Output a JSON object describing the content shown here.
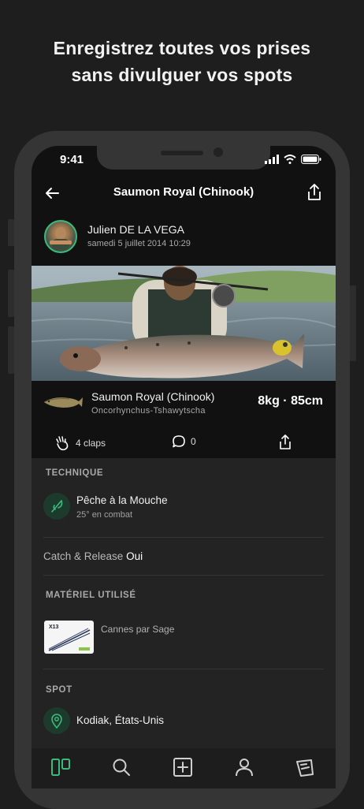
{
  "headline": {
    "line1": "Enregistrez toutes vos prises",
    "line2": "sans divulguer vos spots"
  },
  "status_bar": {
    "time": "9:41",
    "icons": [
      "signal-icon",
      "wifi-icon",
      "battery-icon"
    ]
  },
  "header": {
    "title": "Saumon Royal (Chinook)"
  },
  "author": {
    "name": "Julien  DE LA VEGA",
    "date": "samedi 5 juillet 2014 10:29"
  },
  "catch": {
    "species": "Saumon Royal (Chinook)",
    "scientific": "Oncorhynchus-Tshawytscha",
    "size": "8kg · 85cm"
  },
  "actions": {
    "claps": "4 claps",
    "comments": "0"
  },
  "technique": {
    "label": "TECHNIQUE",
    "name": "Pêche à la Mouche",
    "detail": "25° en combat"
  },
  "catch_release": {
    "label": "Catch & Release",
    "value": "Oui"
  },
  "material": {
    "label": "MATÉRIEL UTILISÉ",
    "item": "Cannes par Sage",
    "card_text": "X13"
  },
  "spot": {
    "label": "SPOT",
    "place": "Kodiak, États-Unis"
  },
  "colors": {
    "accent": "#3cba7c",
    "background": "#1e1e1e",
    "panel": "#232323"
  },
  "tabbar": [
    "feed-icon",
    "search-icon",
    "add-icon",
    "profile-icon",
    "map-icon"
  ]
}
